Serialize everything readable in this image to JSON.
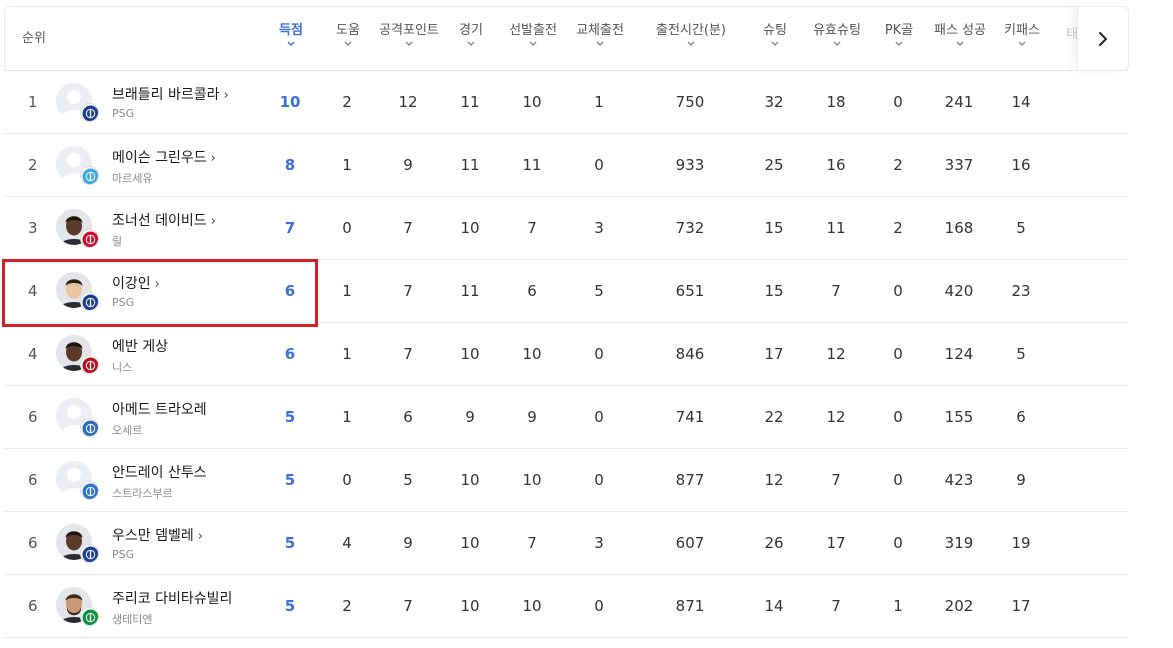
{
  "header": {
    "rank_label": "순위",
    "columns": [
      {
        "key": "goals",
        "label": "득점"
      },
      {
        "key": "assists",
        "label": "도움"
      },
      {
        "key": "attack_points",
        "label": "공격포인트"
      },
      {
        "key": "games",
        "label": "경기"
      },
      {
        "key": "starts",
        "label": "선발출전"
      },
      {
        "key": "subs",
        "label": "교체출전"
      },
      {
        "key": "minutes",
        "label": "출전시간(분)"
      },
      {
        "key": "shots",
        "label": "슈팅"
      },
      {
        "key": "shots_on_target",
        "label": "유효슈팅"
      },
      {
        "key": "pk_goals",
        "label": "PK골"
      },
      {
        "key": "passes",
        "label": "패스 성공"
      },
      {
        "key": "key_passes",
        "label": "키패스"
      }
    ],
    "cut_column": "태",
    "next_icon": "chevron-right-icon"
  },
  "rows": [
    {
      "rank": "1",
      "name": "브래들리 바르콜라",
      "arrow": "›",
      "team": "PSG",
      "club_color": "#1d3f8f",
      "avatar": "placeholder",
      "stats": [
        "10",
        "2",
        "12",
        "11",
        "10",
        "1",
        "750",
        "32",
        "18",
        "0",
        "241",
        "14"
      ]
    },
    {
      "rank": "2",
      "name": "메이슨 그린우드",
      "arrow": "›",
      "team": "마르세유",
      "club_color": "#39a9db",
      "avatar": "placeholder",
      "stats": [
        "8",
        "1",
        "9",
        "11",
        "11",
        "0",
        "933",
        "25",
        "16",
        "2",
        "337",
        "16"
      ]
    },
    {
      "rank": "3",
      "name": "조너선 데이비드",
      "arrow": "›",
      "team": "릴",
      "club_color": "#c8102e",
      "avatar": "photo-dark",
      "stats": [
        "7",
        "0",
        "7",
        "10",
        "7",
        "3",
        "732",
        "15",
        "11",
        "2",
        "168",
        "5"
      ]
    },
    {
      "rank": "4",
      "name": "이강인",
      "arrow": "›",
      "team": "PSG",
      "club_color": "#1d3f8f",
      "avatar": "photo-light",
      "stats": [
        "6",
        "1",
        "7",
        "11",
        "6",
        "5",
        "651",
        "15",
        "7",
        "0",
        "420",
        "23"
      ]
    },
    {
      "rank": "4",
      "name": "에반 게상",
      "arrow": "",
      "team": "니스",
      "club_color": "#b5121b",
      "avatar": "photo-dark",
      "stats": [
        "6",
        "1",
        "7",
        "10",
        "10",
        "0",
        "846",
        "17",
        "12",
        "0",
        "124",
        "5"
      ]
    },
    {
      "rank": "6",
      "name": "아메드 트라오레",
      "arrow": "",
      "team": "오세르",
      "club_color": "#2e6bb6",
      "avatar": "placeholder",
      "stats": [
        "5",
        "1",
        "6",
        "9",
        "9",
        "0",
        "741",
        "22",
        "12",
        "0",
        "155",
        "6"
      ]
    },
    {
      "rank": "6",
      "name": "안드레이 산투스",
      "arrow": "",
      "team": "스트라스부르",
      "club_color": "#2a73c5",
      "avatar": "placeholder",
      "stats": [
        "5",
        "0",
        "5",
        "10",
        "10",
        "0",
        "877",
        "12",
        "7",
        "0",
        "423",
        "9"
      ]
    },
    {
      "rank": "6",
      "name": "우스만 뎀벨레",
      "arrow": "›",
      "team": "PSG",
      "club_color": "#1d3f8f",
      "avatar": "photo-dark",
      "stats": [
        "5",
        "4",
        "9",
        "10",
        "7",
        "3",
        "607",
        "26",
        "17",
        "0",
        "319",
        "19"
      ]
    },
    {
      "rank": "6",
      "name": "주리코 다비타슈빌리",
      "arrow": "",
      "team": "생테티엔",
      "club_color": "#0a8f3c",
      "avatar": "photo-beard",
      "stats": [
        "5",
        "2",
        "7",
        "10",
        "10",
        "0",
        "871",
        "14",
        "7",
        "1",
        "202",
        "17"
      ]
    }
  ],
  "highlight": {
    "row_index": 3,
    "color": "#d62027"
  },
  "colors": {
    "accent": "#3d6fd6",
    "text": "#333333",
    "muted": "#8a8a8a",
    "divider": "#ececec"
  }
}
